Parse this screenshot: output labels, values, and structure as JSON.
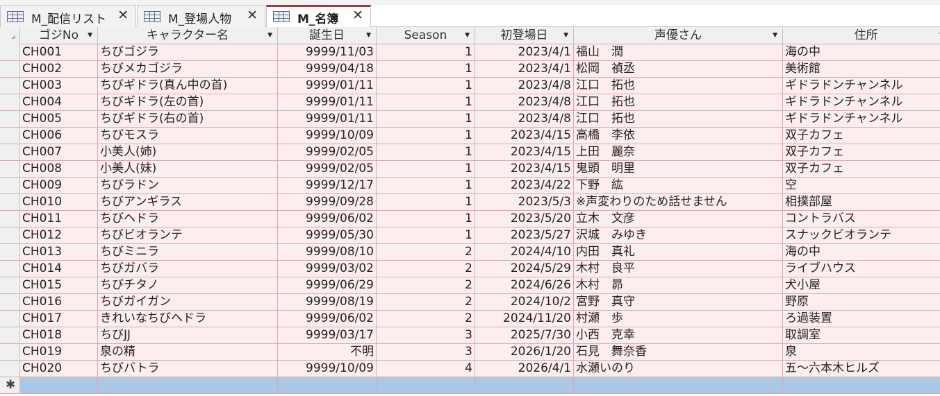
{
  "tabs": [
    {
      "label": "M_配信リスト",
      "close": "✕",
      "active": false
    },
    {
      "label": "M_登場人物",
      "close": "✕",
      "active": false
    },
    {
      "label": "M_名簿",
      "close": "✕",
      "active": true
    }
  ],
  "columns": [
    {
      "label": "ゴジNo"
    },
    {
      "label": "キャラクター名"
    },
    {
      "label": "誕生日"
    },
    {
      "label": "Season"
    },
    {
      "label": "初登場日"
    },
    {
      "label": "声優さん"
    },
    {
      "label": "住所"
    }
  ],
  "dropdown_glyph": "▼",
  "new_record_marker": "✱",
  "rows": [
    [
      "CH001",
      "ちびゴジラ",
      "9999/11/03",
      "1",
      "2023/4/1",
      "福山　潤",
      "海の中"
    ],
    [
      "CH002",
      "ちびメカゴジラ",
      "9999/04/18",
      "1",
      "2023/4/1",
      "松岡　禎丞",
      "美術館"
    ],
    [
      "CH003",
      "ちびギドラ(真ん中の首)",
      "9999/01/11",
      "1",
      "2023/4/8",
      "江口　拓也",
      "ギドラドンチャンネル"
    ],
    [
      "CH004",
      "ちびギドラ(左の首)",
      "9999/01/11",
      "1",
      "2023/4/8",
      "江口　拓也",
      "ギドラドンチャンネル"
    ],
    [
      "CH005",
      "ちびギドラ(右の首)",
      "9999/01/11",
      "1",
      "2023/4/8",
      "江口　拓也",
      "ギドラドンチャンネル"
    ],
    [
      "CH006",
      "ちびモスラ",
      "9999/10/09",
      "1",
      "2023/4/15",
      "高橋　李依",
      "双子カフェ"
    ],
    [
      "CH007",
      "小美人(姉)",
      "9999/02/05",
      "1",
      "2023/4/15",
      "上田　麗奈",
      "双子カフェ"
    ],
    [
      "CH008",
      "小美人(妹)",
      "9999/02/05",
      "1",
      "2023/4/15",
      "鬼頭　明里",
      "双子カフェ"
    ],
    [
      "CH009",
      "ちびラドン",
      "9999/12/17",
      "1",
      "2023/4/22",
      "下野　紘",
      "空"
    ],
    [
      "CH010",
      "ちびアンギラス",
      "9999/09/28",
      "1",
      "2023/5/3",
      "※声変わりのため話せません",
      "相撲部屋"
    ],
    [
      "CH011",
      "ちびヘドラ",
      "9999/06/02",
      "1",
      "2023/5/20",
      "立木　文彦",
      "コントラバス"
    ],
    [
      "CH012",
      "ちびビオランテ",
      "9999/05/30",
      "1",
      "2023/5/27",
      "沢城　みゆき",
      "スナックビオランテ"
    ],
    [
      "CH013",
      "ちびミニラ",
      "9999/08/10",
      "2",
      "2024/4/10",
      "内田　真礼",
      "海の中"
    ],
    [
      "CH014",
      "ちびガバラ",
      "9999/03/02",
      "2",
      "2024/5/29",
      "木村　良平",
      "ライブハウス"
    ],
    [
      "CH015",
      "ちびチタノ",
      "9999/06/29",
      "2",
      "2024/6/26",
      "木村　昴",
      "犬小屋"
    ],
    [
      "CH016",
      "ちびガイガン",
      "9999/08/19",
      "2",
      "2024/10/2",
      "宮野　真守",
      "野原"
    ],
    [
      "CH017",
      "きれいなちびヘドラ",
      "9999/06/02",
      "2",
      "2024/11/20",
      "村瀬　歩",
      "ろ過装置"
    ],
    [
      "CH018",
      "ちびJJ",
      "9999/03/17",
      "3",
      "2025/7/30",
      "小西　克幸",
      "取調室"
    ],
    [
      "CH019",
      "泉の精",
      "不明",
      "3",
      "2026/1/20",
      "石見　舞奈香",
      "泉"
    ],
    [
      "CH020",
      "ちびバトラ",
      "9999/10/09",
      "4",
      "2026/4/1",
      "水瀬いのり",
      "五～六本木ヒルズ"
    ]
  ]
}
